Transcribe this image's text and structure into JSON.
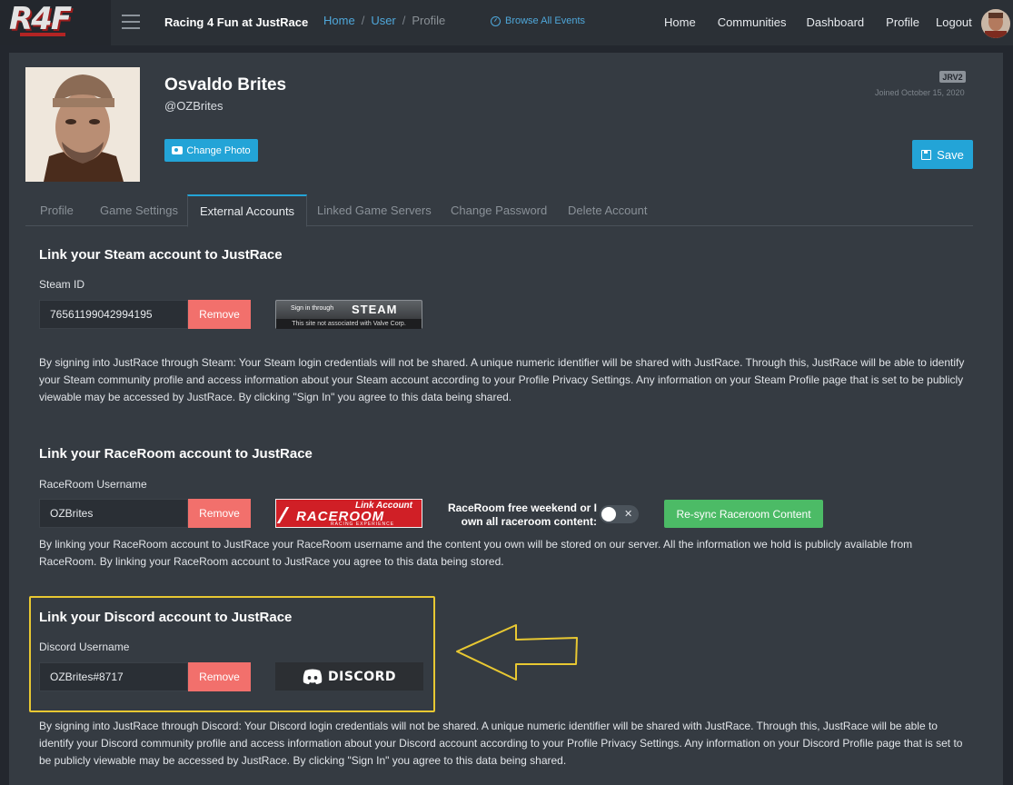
{
  "header": {
    "logo_text": "R4F",
    "app_title": "Racing 4 Fun at JustRace",
    "breadcrumb": [
      "Home",
      "User",
      "Profile"
    ],
    "breadcrumb_sep": "/",
    "browse_label": "Browse All Events",
    "nav": [
      "Home",
      "Communities",
      "Dashboard",
      "Profile",
      "Logout"
    ]
  },
  "profile": {
    "name": "Osvaldo Brites",
    "handle": "@OZBrites",
    "change_photo_label": "Change Photo",
    "badge": "JRV2",
    "joined": "Joined October 15, 2020",
    "save_label": "Save"
  },
  "tabs": [
    "Profile",
    "Game Settings",
    "External Accounts",
    "Linked Game Servers",
    "Change Password",
    "Delete Account"
  ],
  "active_tab": "External Accounts",
  "steam": {
    "title": "Link your Steam account to JustRace",
    "field_label": "Steam ID",
    "value": "76561199042994195",
    "remove_label": "Remove",
    "button_signin": "Sign in through",
    "button_word": "STEAM",
    "button_note": "This site not associated with Valve Corp.",
    "description": "By signing into JustRace through Steam: Your Steam login credentials will not be shared. A unique numeric identifier will be shared with JustRace. Through this, JustRace will be able to identify your Steam community profile and access information about your Steam account according to your Profile Privacy Settings. Any information on your Steam Profile page that is set to be publicly viewable may be accessed by JustRace. By clicking \"Sign In\" you agree to this data being shared."
  },
  "raceroom": {
    "title": "Link your RaceRoom account to JustRace",
    "field_label": "RaceRoom Username",
    "value": "OZBrites",
    "remove_label": "Remove",
    "button_link": "Link Account",
    "button_word": "RACEROOM",
    "button_sub": "RACING EXPERIENCE",
    "toggle_label": "RaceRoom free weekend or I own all raceroom content:",
    "toggle_on": false,
    "resync_label": "Re-sync Raceroom Content",
    "description": "By linking your RaceRoom account to JustRace your RaceRoom username and the content you own will be stored on our server. All the information we hold is publicly available from RaceRoom. By linking your RaceRoom account to JustRace you agree to this data being stored."
  },
  "discord": {
    "title": "Link your Discord account to JustRace",
    "field_label": "Discord Username",
    "value": "OZBrites#8717",
    "remove_label": "Remove",
    "button_word": "DISCORD",
    "description": "By signing into JustRace through Discord: Your Discord login credentials will not be shared. A unique numeric identifier will be shared with JustRace. Through this, JustRace will be able to identify your Discord community profile and access information about your Discord account according to your Profile Privacy Settings. Any information on your Discord Profile page that is set to be publicly viewable may be accessed by JustRace. By clicking \"Sign In\" you agree to this data being shared."
  },
  "colors": {
    "accent": "#23a4d7",
    "remove": "#f2706c",
    "resync": "#4cbb66",
    "highlight": "#e8c832"
  }
}
